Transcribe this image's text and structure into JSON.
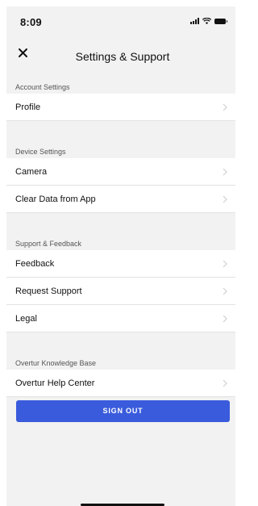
{
  "status_bar": {
    "time": "8:09"
  },
  "header": {
    "title": "Settings & Support"
  },
  "sections": {
    "account": {
      "title": "Account Settings",
      "items": [
        "Profile"
      ]
    },
    "device": {
      "title": "Device Settings",
      "items": [
        "Camera",
        "Clear Data from App"
      ]
    },
    "support": {
      "title": "Support & Feedback",
      "items": [
        "Feedback",
        "Request Support",
        "Legal"
      ]
    },
    "knowledge": {
      "title": "Overtur Knowledge Base",
      "items": [
        "Overtur Help Center"
      ]
    }
  },
  "sign_out_label": "SIGN OUT",
  "colors": {
    "accent": "#3a5bdc",
    "background": "#f2f2f2"
  },
  "icons": [
    "close-icon",
    "chevron-right-icon",
    "signal-icon",
    "wifi-icon",
    "battery-icon"
  ]
}
